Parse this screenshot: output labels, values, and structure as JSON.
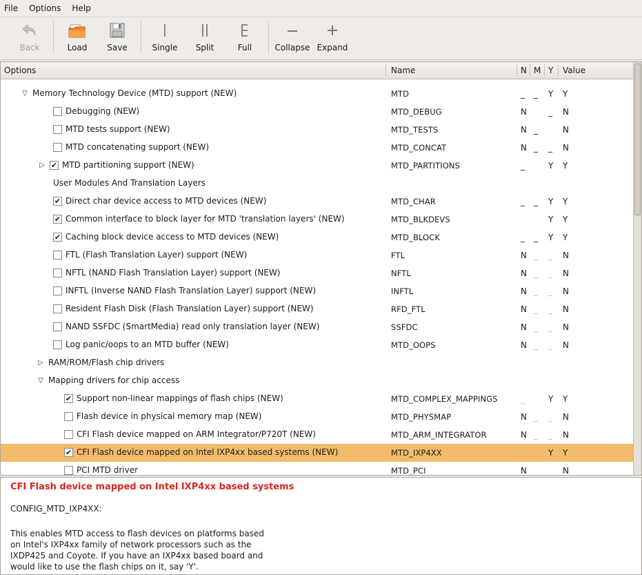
{
  "menubar": {
    "items": [
      "File",
      "Options",
      "Help"
    ]
  },
  "toolbar": {
    "back": "Back",
    "load": "Load",
    "save": "Save",
    "single": "Single",
    "split": "Split",
    "full": "Full",
    "collapse": "Collapse",
    "expand": "Expand"
  },
  "columns": {
    "options": "Options",
    "name": "Name",
    "n": "N",
    "m": "M",
    "y": "Y",
    "value": "Value"
  },
  "rows": [
    {
      "label": "Memory Technology Device (MTD) support (NEW)",
      "name": "MTD",
      "n": "_",
      "m": "_",
      "y": "Y",
      "value": "Y"
    },
    {
      "label": "Debugging (NEW)",
      "name": "MTD_DEBUG",
      "n": "N",
      "m": "",
      "y": "_",
      "value": "N"
    },
    {
      "label": "MTD tests support (NEW)",
      "name": "MTD_TESTS",
      "n": "N",
      "m": "_",
      "y": "",
      "value": "N"
    },
    {
      "label": "MTD concatenating support (NEW)",
      "name": "MTD_CONCAT",
      "n": "N",
      "m": "_",
      "y": "_",
      "value": "N"
    },
    {
      "label": "MTD partitioning support (NEW)",
      "name": "MTD_PARTITIONS",
      "n": "_",
      "m": "",
      "y": "Y",
      "value": "Y"
    },
    {
      "label": "User Modules And Translation Layers",
      "name": "",
      "n": "",
      "m": "",
      "y": "",
      "value": ""
    },
    {
      "label": "Direct char device access to MTD devices (NEW)",
      "name": "MTD_CHAR",
      "n": "_",
      "m": "_",
      "y": "Y",
      "value": "Y"
    },
    {
      "label": "Common interface to block layer for MTD 'translation layers' (NEW)",
      "name": "MTD_BLKDEVS",
      "n": "",
      "m": "",
      "y": "Y",
      "value": "Y"
    },
    {
      "label": "Caching block device access to MTD devices (NEW)",
      "name": "MTD_BLOCK",
      "n": "_",
      "m": "_",
      "y": "Y",
      "value": "Y"
    },
    {
      "label": "FTL (Flash Translation Layer) support (NEW)",
      "name": "FTL",
      "n": "N",
      "m": "_",
      "y": "_",
      "value": "N"
    },
    {
      "label": "NFTL (NAND Flash Translation Layer) support (NEW)",
      "name": "NFTL",
      "n": "N",
      "m": "_",
      "y": "_",
      "value": "N"
    },
    {
      "label": "INFTL (Inverse NAND Flash Translation Layer) support (NEW)",
      "name": "INFTL",
      "n": "N",
      "m": "_",
      "y": "_",
      "value": "N"
    },
    {
      "label": "Resident Flash Disk (Flash Translation Layer) support (NEW)",
      "name": "RFD_FTL",
      "n": "N",
      "m": "_",
      "y": "_",
      "value": "N"
    },
    {
      "label": "NAND SSFDC (SmartMedia) read only translation layer (NEW)",
      "name": "SSFDC",
      "n": "N",
      "m": "_",
      "y": "_",
      "value": "N"
    },
    {
      "label": "Log panic/oops to an MTD buffer (NEW)",
      "name": "MTD_OOPS",
      "n": "N",
      "m": "_",
      "y": "_",
      "value": "N"
    },
    {
      "label": "RAM/ROM/Flash chip drivers",
      "name": "",
      "n": "",
      "m": "",
      "y": "",
      "value": ""
    },
    {
      "label": "Mapping drivers for chip access",
      "name": "",
      "n": "",
      "m": "",
      "y": "",
      "value": ""
    },
    {
      "label": "Support non-linear mappings of flash chips (NEW)",
      "name": "MTD_COMPLEX_MAPPINGS",
      "n": "_",
      "m": "",
      "y": "Y",
      "value": "Y"
    },
    {
      "label": "Flash device in physical memory map (NEW)",
      "name": "MTD_PHYSMAP",
      "n": "N",
      "m": "_",
      "y": "_",
      "value": "N"
    },
    {
      "label": "CFI Flash device mapped on ARM Integrator/P720T (NEW)",
      "name": "MTD_ARM_INTEGRATOR",
      "n": "N",
      "m": "_",
      "y": "_",
      "value": "N"
    },
    {
      "label": "CFI Flash device mapped on Intel IXP4xx based systems (NEW)",
      "name": "MTD_IXP4XX",
      "n": "_",
      "m": "_",
      "y": "Y",
      "value": "Y"
    },
    {
      "label": "PCI MTD driver",
      "name": "MTD_PCI",
      "n": "N",
      "m": "",
      "y": "",
      "value": "N"
    }
  ],
  "help": {
    "title": "CFI Flash device mapped on Intel IXP4xx based systems",
    "config": "CONFIG_MTD_IXP4XX:",
    "body": "This enables MTD access to flash devices on platforms based\non Intel's IXP4xx family of network processors such as the\nIXDP425 and Coyote. If you have an IXP4xx based board and\nwould like to use the flash chips on it, say 'Y'."
  },
  "colors": {
    "selection": "#f2bb6b",
    "help_title": "#d9251d"
  }
}
